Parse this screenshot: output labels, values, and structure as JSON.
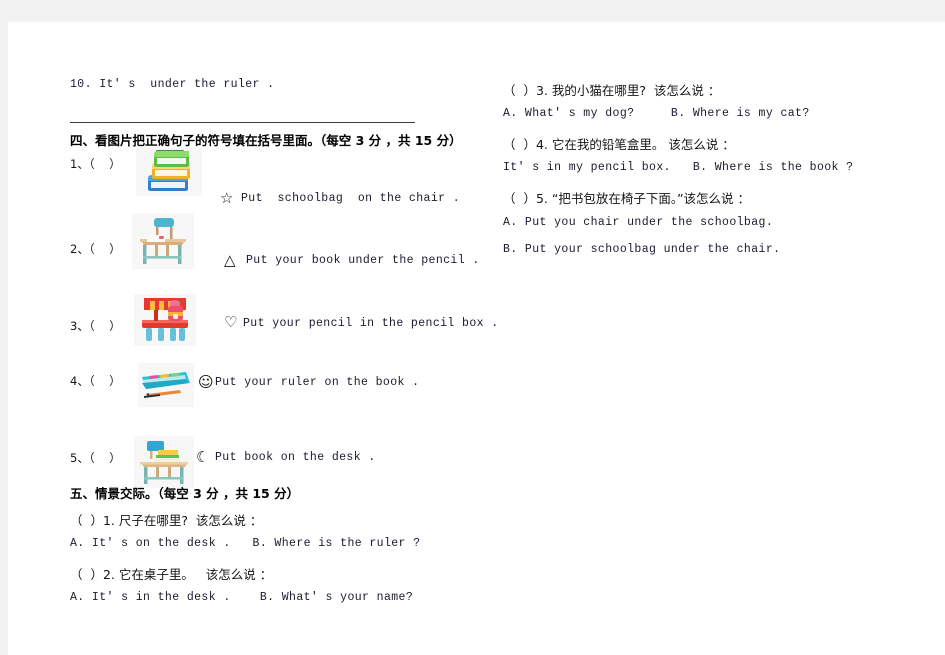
{
  "page": {
    "background": "#f2f2f2",
    "sheet_color": "#ffffff"
  },
  "left_column": {
    "line_top": "10. It' s  under the ruler .",
    "section_four": {
      "heading": "四、看图片把正确句子的符号填在括号里面。（每空 3 分 ，共 15 分）",
      "items": [
        {
          "number": "1、（    ）",
          "picture": "stack-of-books",
          "symbol": "☆",
          "sentence": "Put  schoolbag  on the chair ."
        },
        {
          "number": "2、（    ）",
          "picture": "school-desk-and-chair",
          "symbol": "△",
          "sentence": "Put your book under the pencil ."
        },
        {
          "number": "3、（    ）",
          "picture": "red-chair-with-schoolbag",
          "symbol": "♡",
          "sentence": "Put your pencil in the pencil box ."
        },
        {
          "number": "4、（    ）",
          "picture": "pencil-box-with-pencils",
          "symbol": "☺",
          "sentence": "Put your ruler on the book ."
        },
        {
          "number": "5、（    ）",
          "picture": "desk-with-books",
          "symbol": "☾",
          "sentence": "Put book on the desk ."
        }
      ]
    },
    "section_five": {
      "heading": "五、情景交际。（每空 3 分 ，共 15 分）",
      "questions": [
        {
          "prompt": "（  ）1. 尺子在哪里?  该怎么说 ：",
          "options": "A. It' s on the desk .   B. Where is the ruler ?"
        },
        {
          "prompt": "（  ）2. 它在桌子里。   该怎么说 ：",
          "options": "A. It' s in the desk .    B. What' s your name?"
        }
      ]
    }
  },
  "right_column": {
    "questions": [
      {
        "prompt": "（  ）3. 我的小猫在哪里?  该怎么说 ：",
        "options": "A. What' s my dog?     B. Where is my cat?"
      },
      {
        "prompt": "（  ）4. 它在我的铅笔盒里。 该怎么说 ：",
        "options": "It' s in my pencil box.   B. Where is the book ?"
      },
      {
        "prompt": "（  ）5. “把书包放在椅子下面。”该怎么说 ：",
        "option_a": "A. Put you chair under the schoolbag.",
        "option_b": "B. Put your schoolbag under the chair."
      }
    ]
  }
}
